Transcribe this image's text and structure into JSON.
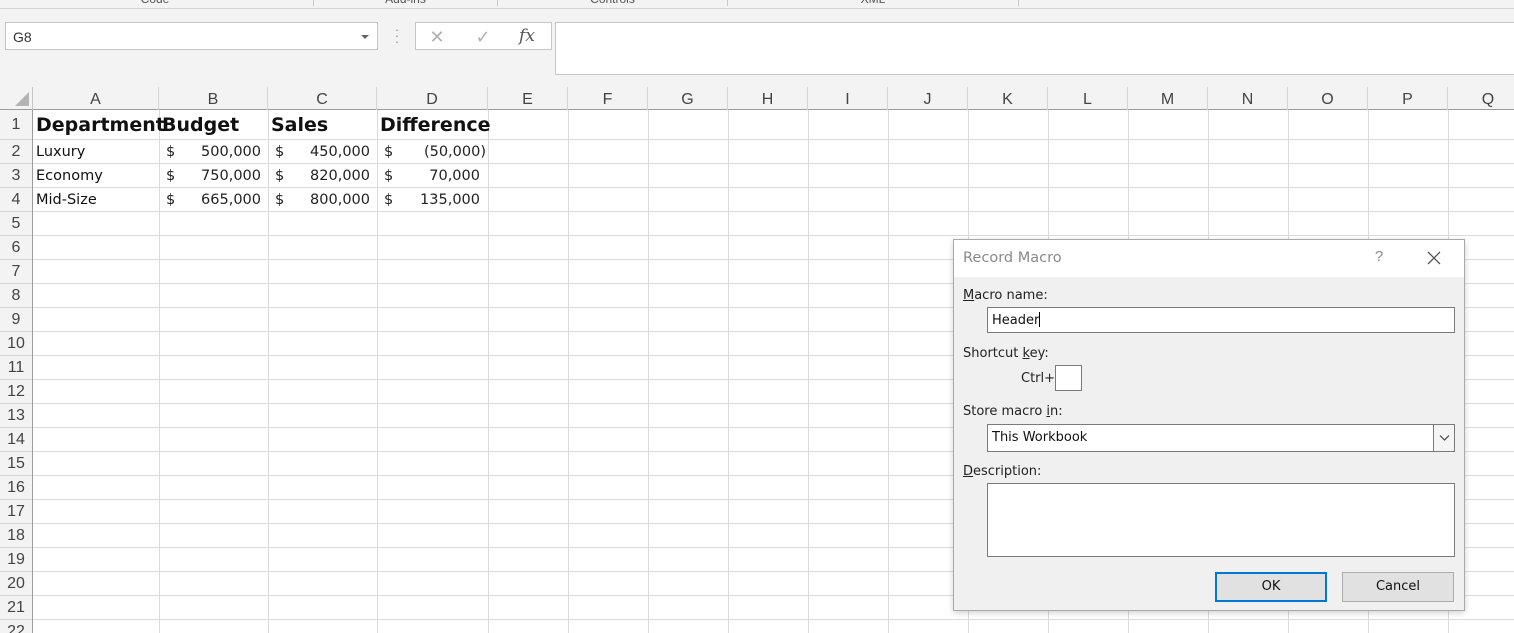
{
  "ribbon": {
    "groups": [
      "Code",
      "Add-ins",
      "Controls",
      "XML"
    ]
  },
  "formula_bar": {
    "name_box": "G8",
    "cancel_symbol": "✕",
    "enter_symbol": "✓",
    "fx_label": "fx",
    "formula": ""
  },
  "sheet": {
    "columns": [
      "A",
      "B",
      "C",
      "D",
      "E",
      "F",
      "G",
      "H",
      "I",
      "J",
      "K",
      "L",
      "M",
      "N",
      "O",
      "P",
      "Q"
    ],
    "rows": [
      "1",
      "2",
      "3",
      "4",
      "5",
      "6",
      "7",
      "8",
      "9",
      "10",
      "11",
      "12",
      "13",
      "14",
      "15",
      "16",
      "17",
      "18",
      "19",
      "20",
      "21",
      "22"
    ],
    "headers": [
      "Department",
      "Budget",
      "Sales",
      "Difference"
    ],
    "currency_symbol": "$",
    "data": [
      {
        "department": "Luxury",
        "budget": "500,000",
        "sales": "450,000",
        "difference": "(50,000)"
      },
      {
        "department": "Economy",
        "budget": "750,000",
        "sales": "820,000",
        "difference": "70,000"
      },
      {
        "department": "Mid-Size",
        "budget": "665,000",
        "sales": "800,000",
        "difference": "135,000"
      }
    ]
  },
  "dialog": {
    "title": "Record Macro",
    "help": "?",
    "macro_name_label_pre": "",
    "macro_name_label_ul": "M",
    "macro_name_label_post": "acro name:",
    "macro_name_value": "Header",
    "shortcut_label_pre": "Shortcut ",
    "shortcut_label_ul": "k",
    "shortcut_label_post": "ey:",
    "ctrl_label": "Ctrl+",
    "shortcut_value": "",
    "store_label_pre": "Store macro ",
    "store_label_ul": "i",
    "store_label_post": "n:",
    "store_value": "This Workbook",
    "description_label_pre": "",
    "description_label_ul": "D",
    "description_label_post": "escription:",
    "description_value": "",
    "ok_label": "OK",
    "cancel_label": "Cancel"
  }
}
